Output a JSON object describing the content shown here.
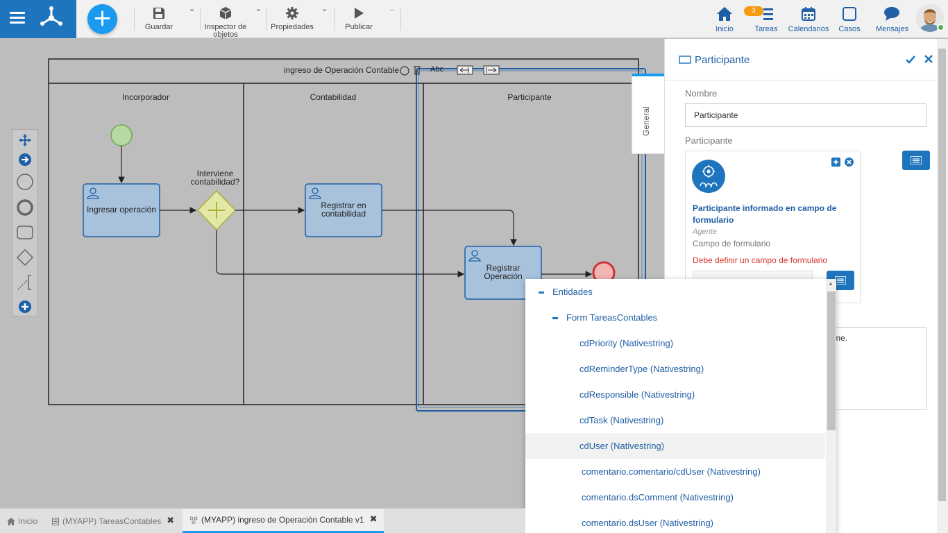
{
  "toolbar": {
    "guardar": "Guardar",
    "inspector_line1": "Inspector de",
    "inspector_line2": "objetos",
    "propiedades": "Propiedades",
    "publicar": "Publicar"
  },
  "nav": {
    "inicio": "Inicio",
    "tareas": "Tareas",
    "tareas_badge": "3",
    "calendarios": "Calendarios",
    "casos": "Casos",
    "mensajes": "Mensajes"
  },
  "diagram": {
    "pool_title": "ingreso de Operación Contable",
    "text_tool": "Abc",
    "lanes": [
      "Incorporador",
      "Contabilidad",
      "Participante"
    ],
    "task_ingresar": "Ingresar operación",
    "gateway_line1": "Interviene",
    "gateway_line2": "contabilidad?",
    "task_registrar_line1": "Registrar en",
    "task_registrar_line2": "contabilidad",
    "task_operacion_line1": "Registrar",
    "task_operacion_line2": "Operación"
  },
  "panel": {
    "title": "Participante",
    "tab_general": "General",
    "nombre_label": "Nombre",
    "nombre_value": "Participante",
    "participante_label": "Participante",
    "card_title": "Participante informado en campo de formulario",
    "card_type": "Agente",
    "card_sub": "Campo de formulario",
    "card_error": "Debe definir un campo de formulario",
    "desc_partial": "rme."
  },
  "dropdown": {
    "root": "Entidades",
    "form": "Form TareasContables",
    "items": [
      "cdPriority (Nativestring)",
      "cdReminderType (Nativestring)",
      "cdResponsible (Nativestring)",
      "cdTask (Nativestring)",
      "cdUser (Nativestring)",
      "comentario.comentario/cdUser (Nativestring)",
      "comentario.dsComment (Nativestring)",
      "comentario.dsUser (Nativestring)"
    ]
  },
  "bottom_tabs": {
    "inicio": "Inicio",
    "tareas_contables": "(MYAPP) TareasContables",
    "proceso": "(MYAPP) ingreso de Operación Contable v1"
  },
  "colors": {
    "brand": "#1f75bd",
    "accent": "#1a9bef",
    "error": "#d9342b",
    "badge": "#f39c12"
  }
}
